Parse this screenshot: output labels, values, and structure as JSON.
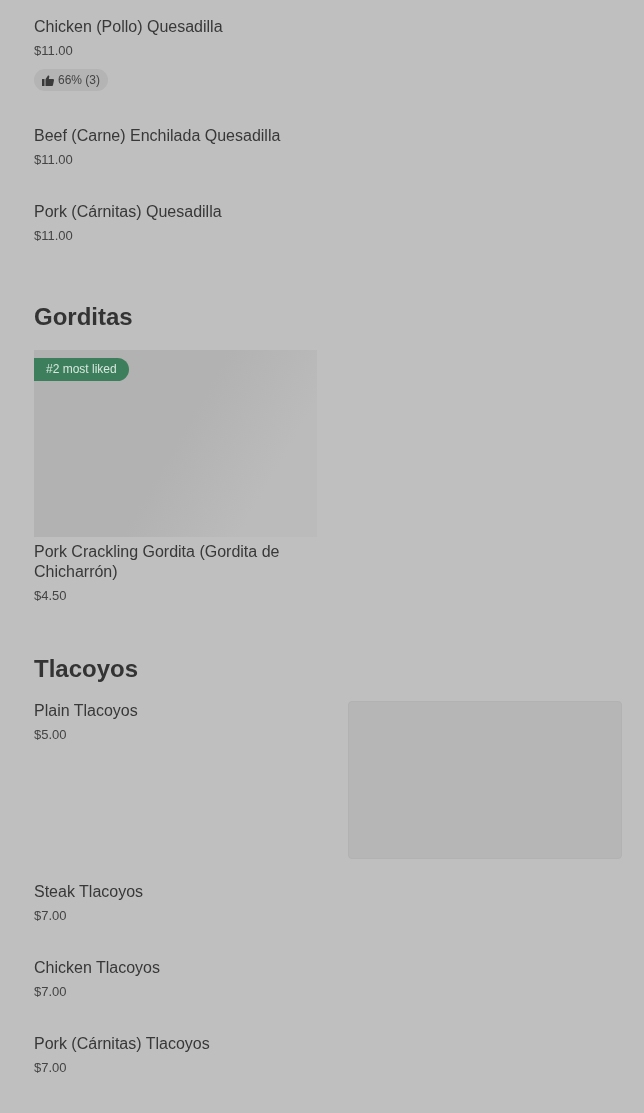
{
  "sections": [
    {
      "items": [
        {
          "kind": "plain",
          "name": "Chicken (Pollo) Quesadilla",
          "price": "$11.00",
          "rating": "66% (3)"
        },
        {
          "kind": "plain",
          "name": "Beef (Carne) Enchilada Quesadilla",
          "price": "$11.00"
        },
        {
          "kind": "plain",
          "name": "Pork (Cárnitas) Quesadilla",
          "price": "$11.00"
        }
      ]
    },
    {
      "title": "Gorditas",
      "items": [
        {
          "kind": "card",
          "name": "Pork Crackling Gordita (Gordita de Chicharrón)",
          "price": "$4.50",
          "badge": "#2 most liked"
        }
      ]
    },
    {
      "title": "Tlacoyos",
      "items": [
        {
          "kind": "thumbnail",
          "name": "Plain Tlacoyos",
          "price": "$5.00"
        },
        {
          "kind": "plain",
          "name": "Steak Tlacoyos",
          "price": "$7.00"
        },
        {
          "kind": "plain",
          "name": "Chicken Tlacoyos",
          "price": "$7.00"
        },
        {
          "kind": "plain",
          "name": "Pork (Cárnitas) Tlacoyos",
          "price": "$7.00"
        }
      ]
    }
  ]
}
